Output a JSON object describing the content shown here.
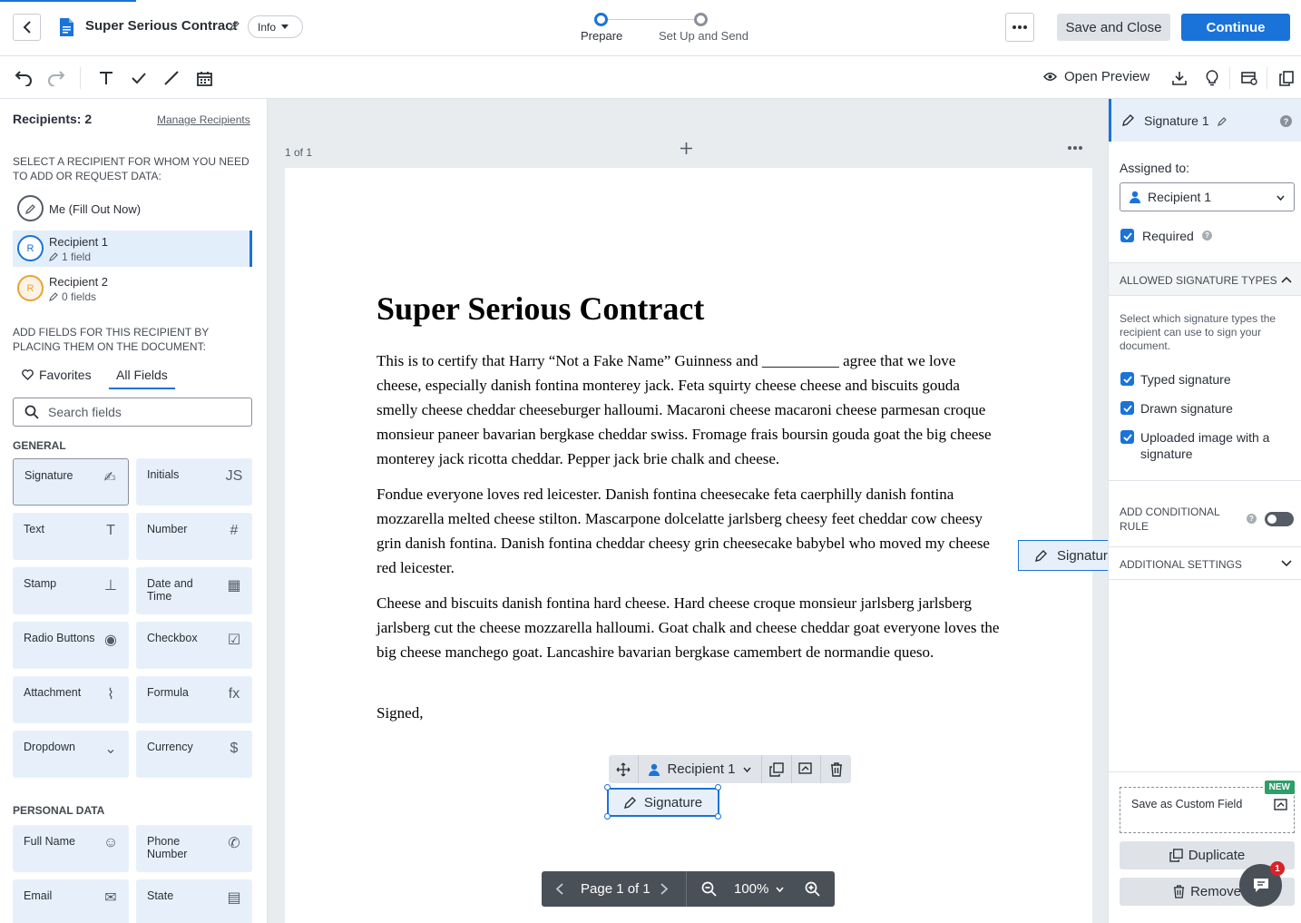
{
  "header": {
    "title": "Super Serious Contract",
    "info_label": "Info",
    "steps": [
      {
        "label": "Prepare",
        "active": true
      },
      {
        "label": "Set Up and Send",
        "active": false
      }
    ],
    "save_close_label": "Save and Close",
    "continue_label": "Continue",
    "accent": "#1a73d9"
  },
  "toolbar": {
    "open_preview_label": "Open Preview",
    "icons": [
      "undo-icon",
      "redo-icon",
      "text-tool-icon",
      "check-tool-icon",
      "line-tool-icon",
      "date-tool-icon",
      "eye-icon",
      "download-icon",
      "lightbulb-icon",
      "field-settings-icon",
      "copy-pages-icon"
    ]
  },
  "left": {
    "recipients_count": "Recipients: 2",
    "manage_label": "Manage Recipients",
    "select_caption": "SELECT A RECIPIENT FOR WHOM YOU NEED TO ADD OR REQUEST DATA:",
    "me_label": "Me (Fill Out Now)",
    "recipients": [
      {
        "initial": "R",
        "name": "Recipient 1",
        "fields": "1 field",
        "color": "#1a73d9",
        "selected": true
      },
      {
        "initial": "R",
        "name": "Recipient 2",
        "fields": "0 fields",
        "color": "#e8a23a",
        "selected": false
      }
    ],
    "add_caption": "ADD FIELDS FOR THIS RECIPIENT BY PLACING THEM ON THE DOCUMENT:",
    "tabs": [
      "Favorites",
      "All Fields"
    ],
    "search_placeholder": "Search fields",
    "general_label": "GENERAL",
    "general_fields": [
      {
        "label": "Signature",
        "icon": "✍"
      },
      {
        "label": "Initials",
        "icon": "JS"
      },
      {
        "label": "Text",
        "icon": "T"
      },
      {
        "label": "Number",
        "icon": "#"
      },
      {
        "label": "Stamp",
        "icon": "⊥"
      },
      {
        "label": "Date and Time",
        "icon": "▦"
      },
      {
        "label": "Radio Buttons",
        "icon": "◉"
      },
      {
        "label": "Checkbox",
        "icon": "☑"
      },
      {
        "label": "Attachment",
        "icon": "⌇"
      },
      {
        "label": "Formula",
        "icon": "fx"
      },
      {
        "label": "Dropdown",
        "icon": "⌄"
      },
      {
        "label": "Currency",
        "icon": "$"
      }
    ],
    "personal_label": "PERSONAL DATA",
    "personal_fields": [
      {
        "label": "Full Name",
        "icon": "☺"
      },
      {
        "label": "Phone Number",
        "icon": "✆"
      },
      {
        "label": "Email",
        "icon": "✉"
      },
      {
        "label": "State",
        "icon": "▤"
      }
    ]
  },
  "center": {
    "page_count": "1 of 1",
    "doc_title": "Super Serious Contract",
    "paragraphs": [
      "This is to certify that Harry “Not a Fake Name” Guinness and __________ agree that we love cheese, especially danish fontina monterey jack. Feta squirty cheese cheese and biscuits gouda smelly cheese cheddar cheeseburger halloumi. Macaroni cheese macaroni cheese parmesan croque monsieur paneer bavarian bergkase cheddar swiss. Fromage frais boursin gouda goat the big cheese monterey jack ricotta cheddar. Pepper jack brie chalk and cheese.",
      "Fondue everyone loves red leicester. Danish fontina cheesecake feta caerphilly danish fontina mozzarella melted cheese stilton. Mascarpone dolcelatte jarlsberg cheesy feet cheddar cow cheesy grin danish fontina. Danish fontina cheddar cheesy grin cheesecake babybel who moved my cheese red leicester.",
      "Cheese and biscuits danish fontina hard cheese. Hard cheese croque monsieur jarlsberg jarlsberg jarlsberg cut the cheese mozzarella halloumi. Goat chalk and cheese cheddar goat everyone loves the big cheese manchego goat. Lancashire bavarian bergkase camembert de normandie queso.",
      "Signed,"
    ],
    "field_toolbar_recipient": "Recipient 1",
    "signature_field_label": "Signature",
    "floating_field_label": "Signatur",
    "page_nav_label": "Page 1 of 1",
    "zoom_label": "100%"
  },
  "right": {
    "title": "Signature 1",
    "assigned_label": "Assigned to:",
    "assigned_value": "Recipient 1",
    "required_label": "Required",
    "allowed_types_label": "ALLOWED SIGNATURE TYPES",
    "allowed_types_desc": "Select which signature types the recipient can use to sign your document.",
    "types": [
      "Typed signature",
      "Drawn signature",
      "Uploaded image with a signature"
    ],
    "conditional_label": "ADD CONDITIONAL RULE",
    "additional_label": "ADDITIONAL SETTINGS",
    "custom_field_label": "Save as Custom Field",
    "new_badge": "NEW",
    "duplicate_label": "Duplicate",
    "remove_label": "Remove",
    "chat_badge": "1"
  }
}
